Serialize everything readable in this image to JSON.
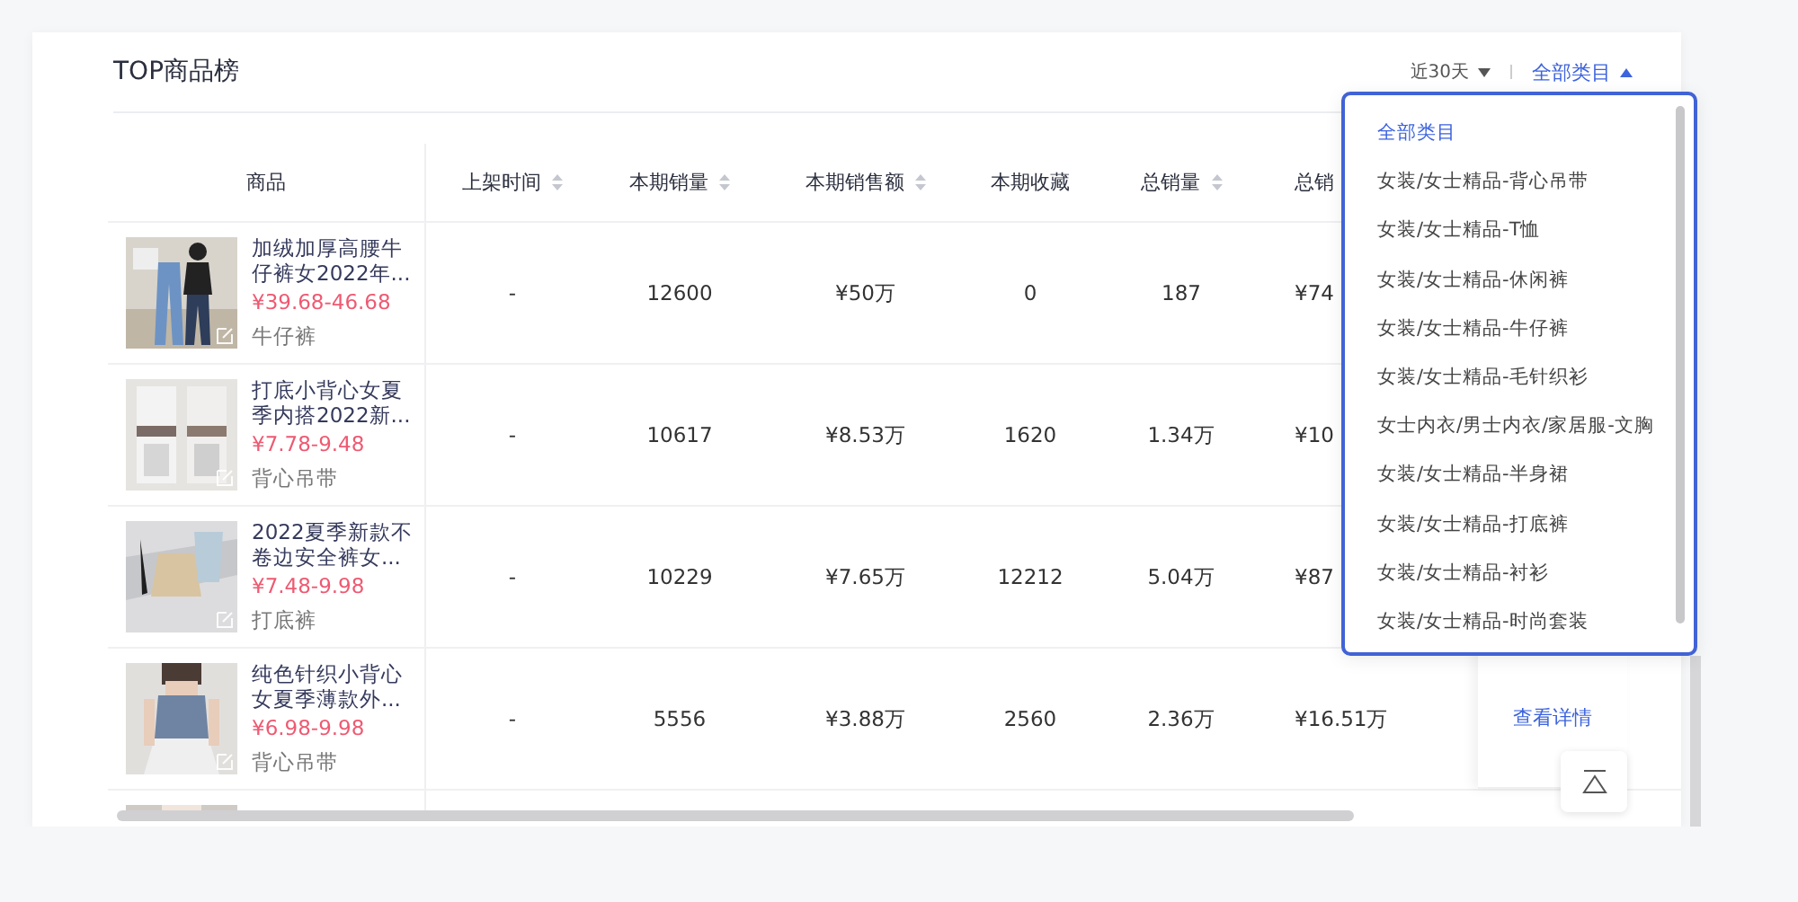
{
  "title": "TOP商品榜",
  "filters": [
    {
      "label": "近30天",
      "expanded": false
    },
    {
      "label": "全部类目",
      "expanded": true
    }
  ],
  "table": {
    "columns": [
      {
        "label": "商品",
        "sortable": false
      },
      {
        "label": "上架时间",
        "sortable": true
      },
      {
        "label": "本期销量",
        "sortable": true
      },
      {
        "label": "本期销售额",
        "sortable": true
      },
      {
        "label": "本期收藏",
        "sortable": false
      },
      {
        "label": "总销量",
        "sortable": true
      },
      {
        "label": "总销"
      }
    ],
    "rows": [
      {
        "kind": "product",
        "title": "加绒加厚高腰牛仔裤女2022年...",
        "price": "¥39.68-46.68",
        "category": "牛仔裤",
        "cells": [
          "-",
          "12600",
          "¥50万",
          "0",
          "187",
          "¥74"
        ]
      },
      {
        "kind": "product",
        "title": "打底小背心女夏季内搭2022新...",
        "price": "¥7.78-9.48",
        "category": "背心吊带",
        "cells": [
          "-",
          "10617",
          "¥8.53万",
          "1620",
          "1.34万",
          "¥10"
        ]
      },
      {
        "kind": "product",
        "title": "2022夏季新款不卷边安全裤女...",
        "price": "¥7.48-9.98",
        "category": "打底裤",
        "cells": [
          "-",
          "10229",
          "¥7.65万",
          "12212",
          "5.04万",
          "¥87"
        ]
      },
      {
        "kind": "product",
        "title": "纯色针织小背心女夏季薄款外...",
        "price": "¥6.98-9.98",
        "category": "背心吊带",
        "cells": [
          "-",
          "5556",
          "¥3.88万",
          "2560",
          "2.36万",
          "¥16.51万"
        ],
        "action": "查看详情"
      },
      {
        "kind": "cut"
      }
    ]
  },
  "menu": {
    "items": [
      {
        "label": "全部类目",
        "selected": true
      },
      {
        "label": "女装/女士精品-背心吊带",
        "selected": false
      },
      {
        "label": "女装/女士精品-T恤",
        "selected": false
      },
      {
        "label": "女装/女士精品-休闲裤",
        "selected": false
      },
      {
        "label": "女装/女士精品-牛仔裤",
        "selected": false
      },
      {
        "label": "女装/女士精品-毛针织衫",
        "selected": false
      },
      {
        "label": "女士内衣/男士内衣/家居服-文胸",
        "selected": false
      },
      {
        "label": "女装/女士精品-半身裙",
        "selected": false
      },
      {
        "label": "女装/女士精品-打底裤",
        "selected": false
      },
      {
        "label": "女装/女士精品-衬衫",
        "selected": false
      },
      {
        "label": "女装/女士精品-时尚套装",
        "selected": false
      }
    ]
  }
}
